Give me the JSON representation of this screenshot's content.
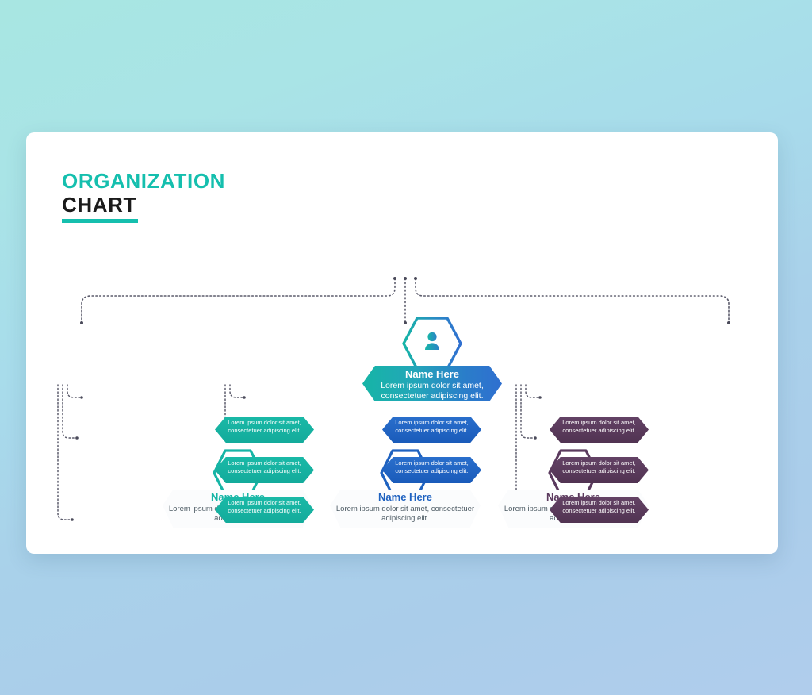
{
  "title": {
    "line1": "ORGANIZATION",
    "line2": "CHART"
  },
  "colors": {
    "accent_teal": "#15bfae",
    "accent_blue": "#1f62c0",
    "accent_purple": "#5b3a5e",
    "title_dark": "#1b1b1b",
    "banner_gradient_start": "#16b5a6",
    "banner_gradient_end": "#2f6fd0",
    "page_bg_top": "#a8e6e2",
    "page_bg_bottom": "#b0cdec",
    "card_bg": "#ffffff"
  },
  "root": {
    "icon": "person-icon",
    "name": "Name Here",
    "description": "Lorem ipsum dolor sit amet, consectetuer adipiscing elit."
  },
  "branches": [
    {
      "id": "teal",
      "icon": "person-icon",
      "name": "Name Here",
      "description": "Lorem ipsum dolor sit amet, consectetuer adipiscing elit.",
      "items": [
        "Lorem ipsum dolor sit amet, consectetuer adipiscing elit.",
        "Lorem ipsum dolor sit amet, consectetuer adipiscing elit.",
        "Lorem ipsum dolor sit amet, consectetuer adipiscing elit."
      ]
    },
    {
      "id": "blue",
      "icon": "person-icon",
      "name": "Name Here",
      "description": "Lorem ipsum dolor sit amet, consectetuer adipiscing elit.",
      "items": [
        "Lorem ipsum dolor sit amet, consectetuer adipiscing elit.",
        "Lorem ipsum dolor sit amet, consectetuer adipiscing elit."
      ]
    },
    {
      "id": "purple",
      "icon": "person-icon",
      "name": "Name Here",
      "description": "Lorem ipsum dolor sit amet, consectetuer adipiscing elit.",
      "items": [
        "Lorem ipsum dolor sit amet, consectetuer adipiscing elit.",
        "Lorem ipsum dolor sit amet, consectetuer adipiscing elit.",
        "Lorem ipsum dolor sit amet, consectetuer adipiscing elit."
      ]
    }
  ]
}
